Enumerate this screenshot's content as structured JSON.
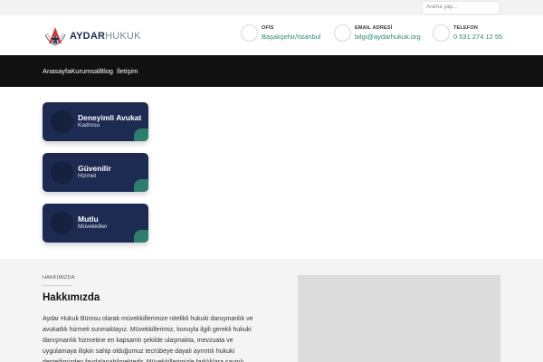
{
  "search": {
    "placeholder": "Arama yap..."
  },
  "logo": {
    "part1": "AYDAR",
    "part2": "HUKUK"
  },
  "info": [
    {
      "label": "OFİS",
      "value": "Başakşehir/İstanbul"
    },
    {
      "label": "EMAIL ADRESİ",
      "value": "bilgi@aydarhukuk.org"
    },
    {
      "label": "TELEFON",
      "value": "0 531 274 12 55"
    }
  ],
  "nav": [
    "Anasayfa",
    "Kurumsal",
    "Blog",
    "İletişim"
  ],
  "cards": [
    {
      "title": "Deneyimli Avukat",
      "subtitle": "Kadrosu"
    },
    {
      "title": "Güvenilir",
      "subtitle": "Hizmet"
    },
    {
      "title": "Mutlu",
      "subtitle": "Müvekkiller"
    }
  ],
  "about": {
    "breadcrumb": "HAKKIMIZDA",
    "title": "Hakkımızda",
    "text": "Aydar Hukuk Bürosu olarak müvekkillerimize nitelikli hukuki danışmanlık ve avukatlık hizmeti sunmaktayız. Müvekkillerimiz, konuyla ilgili gerekli hukuki danışmanlık hizmetine en kapsamlı şekilde ulaşmakta, mevzuata ve uygulamaya ilişkin sahip olduğumuz tecrübeye dayalı ayrıntılı hukuki desteğimizden faydalanabilmektedir. Müvekkillerimizle farklıklara saygılı"
  },
  "colors": {
    "navy": "#1d2b52",
    "teal": "#2a8a73",
    "navbar": "#111111"
  }
}
